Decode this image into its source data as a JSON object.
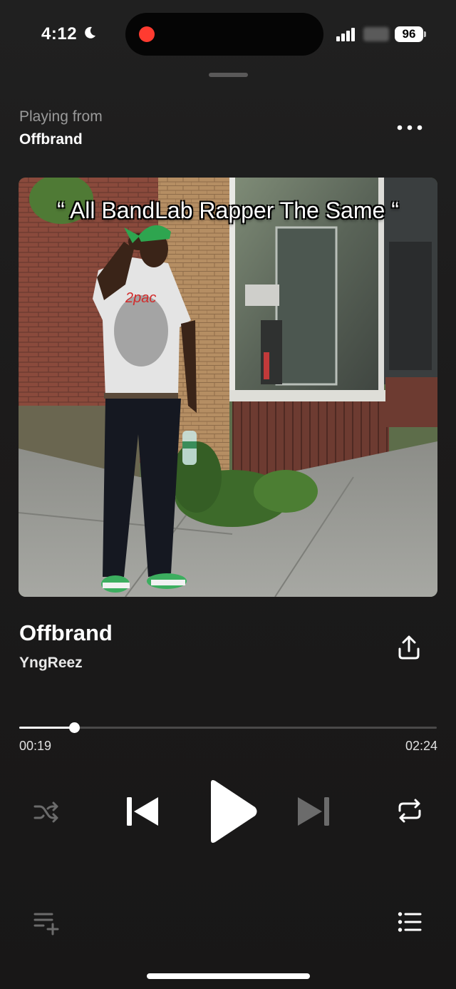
{
  "status_bar": {
    "time": "4:12",
    "battery": "96"
  },
  "header": {
    "playing_from_label": "Playing from",
    "source_name": "Offbrand"
  },
  "artwork": {
    "caption": "“ All BandLab Rapper The Same “"
  },
  "track": {
    "title": "Offbrand",
    "artist": "YngReez"
  },
  "progress": {
    "elapsed": "00:19",
    "total": "02:24",
    "fraction": 0.1319
  },
  "controls": {
    "shuffle_icon": "shuffle-icon",
    "previous_icon": "skip-previous-icon",
    "play_icon": "play-icon",
    "next_icon": "skip-next-icon",
    "repeat_icon": "repeat-icon"
  },
  "colors": {
    "background": "#1c1b1b",
    "progress_fill": "#ffffff",
    "progress_track": "#4a4949",
    "recording_dot": "#ff3b30",
    "disabled_icon": "#6b6b6b"
  }
}
